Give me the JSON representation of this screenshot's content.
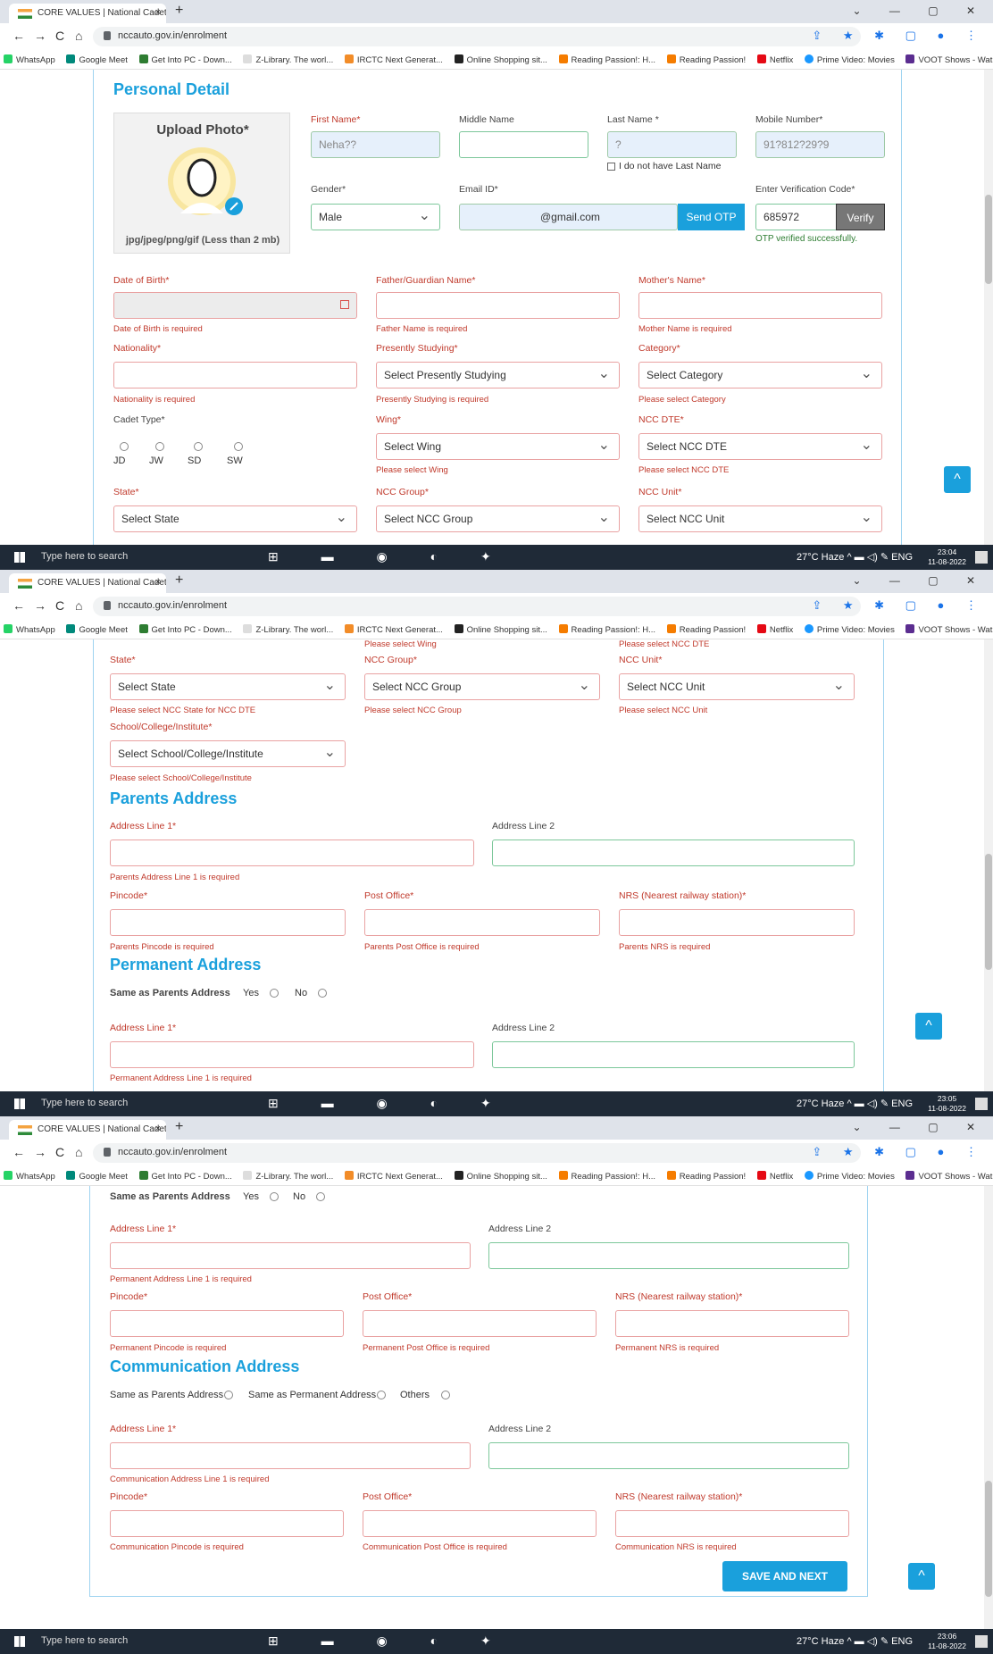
{
  "browser": {
    "tab_title": "CORE VALUES | National Cadet C",
    "tab_close": "×",
    "new_tab": "+",
    "url": "nccauto.gov.in/enrolment",
    "window_controls": "⌄ — ▢ ✕",
    "nav": {
      "back": "←",
      "forward": "→",
      "reload": "C",
      "home": "⌂"
    },
    "toolbar_icons": "⇪ ★ ✱ ▢ ● ⋮",
    "bookmarks": [
      "WhatsApp",
      "Google Meet",
      "Get Into PC - Down...",
      "Z-Library. The worl...",
      "IRCTC Next Generat...",
      "Online Shopping sit...",
      "Reading Passion!: H...",
      "Reading Passion!",
      "Netflix",
      "Prime Video: Movies",
      "VOOT Shows - Wat..."
    ],
    "bookmarks_more": "»"
  },
  "taskbar": {
    "search_placeholder": "Type here to search",
    "app_icons": "⊞ ▬ ◉ ◐ ✦",
    "weather": "27°C Haze",
    "tray": "^ ▬ ◁) ✎ ENG",
    "date": "11-08-2022",
    "times": [
      "23:04",
      "23:05",
      "23:06"
    ]
  },
  "to_top": "^",
  "personal": {
    "title": "Personal Detail",
    "upload_title": "Upload Photo*",
    "upload_hint": "jpg/jpeg/png/gif (Less than 2 mb)",
    "first_name_label": "First Name*",
    "first_name_value": "Neha??",
    "middle_name_label": "Middle Name",
    "last_name_label": "Last Name *",
    "last_name_value": "?",
    "no_last_name": "I do not have Last Name",
    "mobile_label": "Mobile Number*",
    "mobile_value": "91?812?29?9",
    "gender_label": "Gender*",
    "gender_value": "Male",
    "email_label": "Email ID*",
    "email_value": "@gmail.com",
    "send_otp": "Send OTP",
    "otp_label": "Enter Verification Code*",
    "otp_value": "685972",
    "verify": "Verify",
    "otp_ok": "OTP verified successfully.",
    "dob_label": "Date of Birth*",
    "dob_err": "Date of Birth is required",
    "father_label": "Father/Guardian Name*",
    "father_err": "Father Name is required",
    "mother_label": "Mother's Name*",
    "mother_err": "Mother Name is required",
    "nationality_label": "Nationality*",
    "nationality_err": "Nationality is required",
    "studying_label": "Presently Studying*",
    "studying_value": "Select Presently Studying",
    "studying_err": "Presently Studying is required",
    "category_label": "Category*",
    "category_value": "Select Category",
    "category_err": "Please select Category",
    "cadet_type_label": "Cadet Type*",
    "cadet_types": [
      "JD",
      "JW",
      "SD",
      "SW"
    ],
    "wing_label": "Wing*",
    "wing_value": "Select Wing",
    "wing_err": "Please select Wing",
    "ncc_dte_label": "NCC DTE*",
    "ncc_dte_value": "Select NCC DTE",
    "ncc_dte_err": "Please select NCC DTE",
    "state_label": "State*",
    "state_value": "Select State",
    "state_err": "Please select NCC State for NCC DTE",
    "group_label": "NCC Group*",
    "group_value": "Select NCC Group",
    "group_err": "Please select NCC Group",
    "unit_label": "NCC Unit*",
    "unit_value": "Select NCC Unit",
    "unit_err": "Please select NCC Unit",
    "school_label": "School/College/Institute*",
    "school_value": "Select School/College/Institute",
    "school_err": "Please select School/College/Institute"
  },
  "parents": {
    "title": "Parents Address",
    "addr1_label": "Address Line 1*",
    "addr1_err": "Parents Address Line 1 is required",
    "addr2_label": "Address Line 2",
    "pincode_label": "Pincode*",
    "pincode_err": "Parents Pincode is required",
    "po_label": "Post Office*",
    "po_err": "Parents Post Office is required",
    "nrs_label": "NRS (Nearest railway station)*",
    "nrs_err": "Parents NRS is required"
  },
  "permanent": {
    "title": "Permanent Address",
    "same_label": "Same as Parents Address",
    "yes": "Yes",
    "no": "No",
    "addr1_label": "Address Line 1*",
    "addr1_err": "Permanent Address Line 1 is required",
    "addr2_label": "Address Line 2",
    "pincode_label": "Pincode*",
    "pincode_err": "Permanent Pincode is required",
    "po_label": "Post Office*",
    "po_err": "Permanent Post Office is required",
    "nrs_label": "NRS (Nearest railway station)*",
    "nrs_err": "Permanent NRS is required"
  },
  "communication": {
    "title": "Communication Address",
    "opt_parents": "Same as Parents Address",
    "opt_permanent": "Same as Permanent Address",
    "opt_others": "Others",
    "addr1_label": "Address Line 1*",
    "addr1_err": "Communication Address Line 1 is required",
    "addr2_label": "Address Line 2",
    "pincode_label": "Pincode*",
    "pincode_err": "Communication Pincode is required",
    "po_label": "Post Office*",
    "po_err": "Communication Post Office is required",
    "nrs_label": "NRS (Nearest railway station)*",
    "nrs_err": "Communication NRS is required"
  },
  "save_next": "SAVE AND NEXT"
}
